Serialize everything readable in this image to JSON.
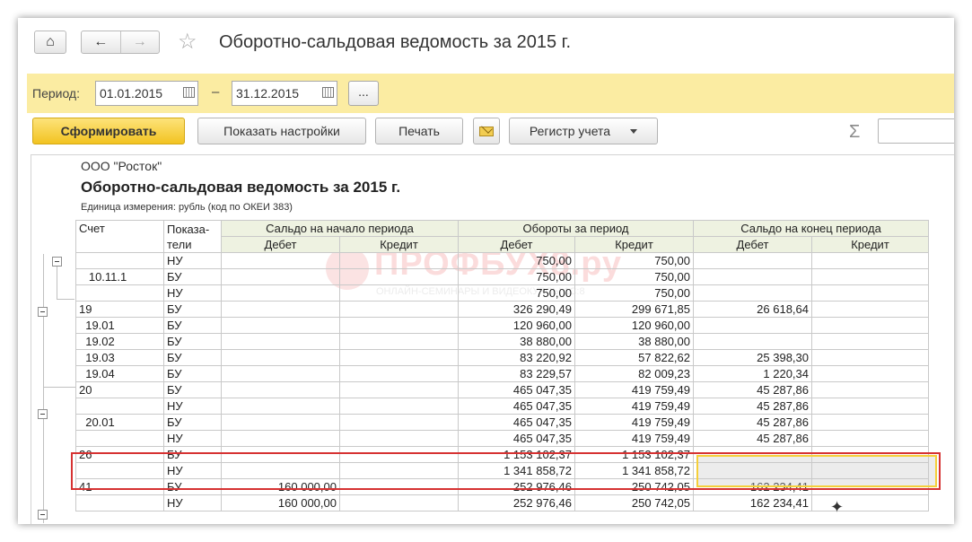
{
  "window": {
    "title": "Оборотно-сальдовая ведомость за 2015 г."
  },
  "period": {
    "label": "Период:",
    "from": "01.01.2015",
    "dash": "–",
    "to": "31.12.2015",
    "more_label": "..."
  },
  "toolbar": {
    "generate_label": "Сформировать",
    "settings_label": "Показать настройки",
    "print_label": "Печать",
    "register_label": "Регистр учета",
    "sigma_label": "Σ"
  },
  "report": {
    "org": "ООО \"Росток\"",
    "title": "Оборотно-сальдовая ведомость за 2015 г.",
    "unit": "Единица измерения:   рубль (код по ОКЕИ 383)",
    "headers": {
      "account": "Счет",
      "indicators": "Показа-\nтели",
      "opening": "Сальдо на начало периода",
      "turnover": "Обороты за период",
      "closing": "Сальдо на конец периода",
      "debit": "Дебет",
      "credit": "Кредит"
    },
    "rows": [
      {
        "account": "",
        "ind": "НУ",
        "od": "",
        "oc": "",
        "td": "750,00",
        "tc": "750,00",
        "cd": "",
        "cc": ""
      },
      {
        "account": "   10.11.1",
        "ind": "БУ",
        "od": "",
        "oc": "",
        "td": "750,00",
        "tc": "750,00",
        "cd": "",
        "cc": ""
      },
      {
        "account": "",
        "ind": "НУ",
        "od": "",
        "oc": "",
        "td": "750,00",
        "tc": "750,00",
        "cd": "",
        "cc": ""
      },
      {
        "account": "19",
        "ind": "БУ",
        "od": "",
        "oc": "",
        "td": "326 290,49",
        "tc": "299 671,85",
        "cd": "26 618,64",
        "cc": ""
      },
      {
        "account": "  19.01",
        "ind": "БУ",
        "od": "",
        "oc": "",
        "td": "120 960,00",
        "tc": "120 960,00",
        "cd": "",
        "cc": ""
      },
      {
        "account": "  19.02",
        "ind": "БУ",
        "od": "",
        "oc": "",
        "td": "38 880,00",
        "tc": "38 880,00",
        "cd": "",
        "cc": ""
      },
      {
        "account": "  19.03",
        "ind": "БУ",
        "od": "",
        "oc": "",
        "td": "83 220,92",
        "tc": "57 822,62",
        "cd": "25 398,30",
        "cc": ""
      },
      {
        "account": "  19.04",
        "ind": "БУ",
        "od": "",
        "oc": "",
        "td": "83 229,57",
        "tc": "82 009,23",
        "cd": "1 220,34",
        "cc": ""
      },
      {
        "account": "20",
        "ind": "БУ",
        "od": "",
        "oc": "",
        "td": "465 047,35",
        "tc": "419 759,49",
        "cd": "45 287,86",
        "cc": ""
      },
      {
        "account": "",
        "ind": "НУ",
        "od": "",
        "oc": "",
        "td": "465 047,35",
        "tc": "419 759,49",
        "cd": "45 287,86",
        "cc": ""
      },
      {
        "account": "  20.01",
        "ind": "БУ",
        "od": "",
        "oc": "",
        "td": "465 047,35",
        "tc": "419 759,49",
        "cd": "45 287,86",
        "cc": ""
      },
      {
        "account": "",
        "ind": "НУ",
        "od": "",
        "oc": "",
        "td": "465 047,35",
        "tc": "419 759,49",
        "cd": "45 287,86",
        "cc": ""
      },
      {
        "account": "26",
        "ind": "БУ",
        "od": "",
        "oc": "",
        "td": "1 153 102,37",
        "tc": "1 153 102,37",
        "cd": "",
        "cc": ""
      },
      {
        "account": "",
        "ind": "НУ",
        "od": "",
        "oc": "",
        "td": "1 341 858,72",
        "tc": "1 341 858,72",
        "cd": "",
        "cc": ""
      },
      {
        "account": "41",
        "ind": "БУ",
        "od": "160 000,00",
        "oc": "",
        "td": "252 976,46",
        "tc": "250 742,05",
        "cd": "162 234,41",
        "cc": ""
      },
      {
        "account": "",
        "ind": "НУ",
        "od": "160 000,00",
        "oc": "",
        "td": "252 976,46",
        "tc": "250 742,05",
        "cd": "162 234,41",
        "cc": ""
      }
    ]
  },
  "watermark": {
    "text": "ПРОФБУХ8.ру",
    "sub": "ОНЛАЙН-СЕМИНАРЫ И ВИДЕОКУРСЫ 1С:8"
  }
}
